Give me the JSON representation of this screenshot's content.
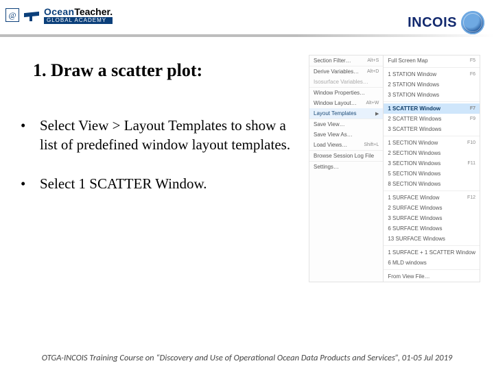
{
  "logos": {
    "oceanteacher": {
      "ocean": "Ocean",
      "teacher": "Teacher.",
      "sub": "GLOBAL ACADEMY",
      "at": "@"
    },
    "incois": {
      "text": "INCOIS"
    }
  },
  "title": "1. Draw a scatter plot:",
  "bullets": [
    "Select View > Layout Templates to show a list of predefined window layout templates.",
    "Select 1 SCATTER Window."
  ],
  "menu": {
    "left": [
      {
        "label": "Section Filter…",
        "sc": "Alt+S",
        "faded": false
      },
      {
        "label": "Derive Variables…",
        "sc": "Alt+D",
        "section": true
      },
      {
        "label": "Isosurface Variables…",
        "faded": true
      },
      {
        "label": "Window Properties…",
        "section": true
      },
      {
        "label": "Window Layout…",
        "sc": "Alt+W"
      },
      {
        "label": "Layout Templates",
        "highlight": true,
        "arrow": true
      },
      {
        "label": "Save View…",
        "section": true
      },
      {
        "label": "Save View As…"
      },
      {
        "label": "Load Views…",
        "sc": "Shift+L"
      },
      {
        "label": "Browse Session Log File",
        "section": true
      },
      {
        "label": "Settings…",
        "section": true
      }
    ],
    "right": [
      {
        "label": "Full Screen Map",
        "sc": "F5"
      },
      {
        "sep": true
      },
      {
        "label": "1 STATION Window",
        "sc": "F6"
      },
      {
        "label": "2 STATION Windows"
      },
      {
        "label": "3 STATION Windows"
      },
      {
        "sep": true
      },
      {
        "label": "1 SCATTER Window",
        "sc": "F7",
        "highlight": true
      },
      {
        "label": "2 SCATTER Windows",
        "sc": "F9"
      },
      {
        "label": "3 SCATTER Windows"
      },
      {
        "sep": true
      },
      {
        "label": "1 SECTION Window",
        "sc": "F10"
      },
      {
        "label": "2 SECTION Windows"
      },
      {
        "label": "3 SECTION Windows",
        "sc": "F11"
      },
      {
        "label": "5 SECTION Windows"
      },
      {
        "label": "8 SECTION Windows"
      },
      {
        "sep": true
      },
      {
        "label": "1 SURFACE Window",
        "sc": "F12"
      },
      {
        "label": "2 SURFACE Windows"
      },
      {
        "label": "3 SURFACE Windows"
      },
      {
        "label": "6 SURFACE Windows"
      },
      {
        "label": "13 SURFACE Windows"
      },
      {
        "sep": true
      },
      {
        "label": "1 SURFACE + 1 SCATTER Window"
      },
      {
        "label": "6 MLD windows"
      },
      {
        "sep": true
      },
      {
        "label": "From View File…"
      }
    ]
  },
  "footer": "OTGA-INCOIS Training Course on “Discovery and Use of Operational Ocean Data Products and Services”, 01-05 Jul 2019"
}
